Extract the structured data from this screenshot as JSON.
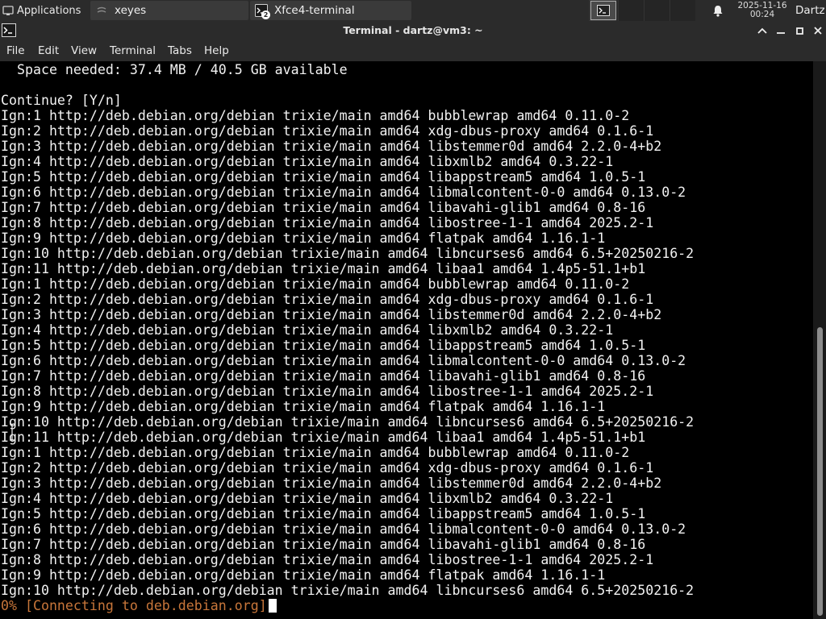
{
  "panel": {
    "applications_label": "Applications",
    "tasks": [
      {
        "label": "xeyes",
        "icon": "xeyes-icon"
      },
      {
        "label": "Xfce4-terminal",
        "icon": "terminal-icon",
        "badge": "2"
      }
    ],
    "clock": {
      "date": "2025-11-16",
      "time": "00:24"
    },
    "user": "Dartz"
  },
  "window": {
    "title": "Terminal - dartz@vm3: ~"
  },
  "menu": {
    "file": "File",
    "edit": "Edit",
    "view": "View",
    "terminal": "Terminal",
    "tabs": "Tabs",
    "help": "Help"
  },
  "terminal": {
    "lines": [
      "  Space needed: 37.4 MB / 40.5 GB available",
      "",
      "Continue? [Y/n]",
      "Ign:1 http://deb.debian.org/debian trixie/main amd64 bubblewrap amd64 0.11.0-2",
      "Ign:2 http://deb.debian.org/debian trixie/main amd64 xdg-dbus-proxy amd64 0.1.6-1",
      "Ign:3 http://deb.debian.org/debian trixie/main amd64 libstemmer0d amd64 2.2.0-4+b2",
      "Ign:4 http://deb.debian.org/debian trixie/main amd64 libxmlb2 amd64 0.3.22-1",
      "Ign:5 http://deb.debian.org/debian trixie/main amd64 libappstream5 amd64 1.0.5-1",
      "Ign:6 http://deb.debian.org/debian trixie/main amd64 libmalcontent-0-0 amd64 0.13.0-2",
      "Ign:7 http://deb.debian.org/debian trixie/main amd64 libavahi-glib1 amd64 0.8-16",
      "Ign:8 http://deb.debian.org/debian trixie/main amd64 libostree-1-1 amd64 2025.2-1",
      "Ign:9 http://deb.debian.org/debian trixie/main amd64 flatpak amd64 1.16.1-1",
      "Ign:10 http://deb.debian.org/debian trixie/main amd64 libncurses6 amd64 6.5+20250216-2",
      "Ign:11 http://deb.debian.org/debian trixie/main amd64 libaa1 amd64 1.4p5-51.1+b1",
      "Ign:1 http://deb.debian.org/debian trixie/main amd64 bubblewrap amd64 0.11.0-2",
      "Ign:2 http://deb.debian.org/debian trixie/main amd64 xdg-dbus-proxy amd64 0.1.6-1",
      "Ign:3 http://deb.debian.org/debian trixie/main amd64 libstemmer0d amd64 2.2.0-4+b2",
      "Ign:4 http://deb.debian.org/debian trixie/main amd64 libxmlb2 amd64 0.3.22-1",
      "Ign:5 http://deb.debian.org/debian trixie/main amd64 libappstream5 amd64 1.0.5-1",
      "Ign:6 http://deb.debian.org/debian trixie/main amd64 libmalcontent-0-0 amd64 0.13.0-2",
      "Ign:7 http://deb.debian.org/debian trixie/main amd64 libavahi-glib1 amd64 0.8-16",
      "Ign:8 http://deb.debian.org/debian trixie/main amd64 libostree-1-1 amd64 2025.2-1",
      "Ign:9 http://deb.debian.org/debian trixie/main amd64 flatpak amd64 1.16.1-1",
      "Ign:10 http://deb.debian.org/debian trixie/main amd64 libncurses6 amd64 6.5+20250216-2",
      "Ign:11 http://deb.debian.org/debian trixie/main amd64 libaa1 amd64 1.4p5-51.1+b1",
      "Ign:1 http://deb.debian.org/debian trixie/main amd64 bubblewrap amd64 0.11.0-2",
      "Ign:2 http://deb.debian.org/debian trixie/main amd64 xdg-dbus-proxy amd64 0.1.6-1",
      "Ign:3 http://deb.debian.org/debian trixie/main amd64 libstemmer0d amd64 2.2.0-4+b2",
      "Ign:4 http://deb.debian.org/debian trixie/main amd64 libxmlb2 amd64 0.3.22-1",
      "Ign:5 http://deb.debian.org/debian trixie/main amd64 libappstream5 amd64 1.0.5-1",
      "Ign:6 http://deb.debian.org/debian trixie/main amd64 libmalcontent-0-0 amd64 0.13.0-2",
      "Ign:7 http://deb.debian.org/debian trixie/main amd64 libavahi-glib1 amd64 0.8-16",
      "Ign:8 http://deb.debian.org/debian trixie/main amd64 libostree-1-1 amd64 2025.2-1",
      "Ign:9 http://deb.debian.org/debian trixie/main amd64 flatpak amd64 1.16.1-1",
      "Ign:10 http://deb.debian.org/debian trixie/main amd64 libncurses6 amd64 6.5+20250216-2"
    ],
    "progress_line": "0% [Connecting to deb.debian.org]",
    "progress_color": "#c8763a",
    "background": "#000000",
    "foreground": "#f2f2f2"
  }
}
